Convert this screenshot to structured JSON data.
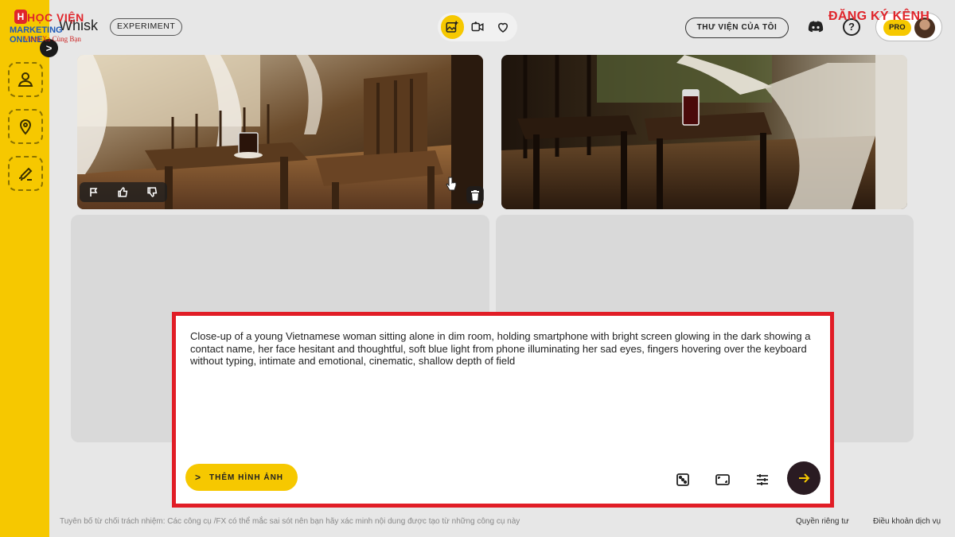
{
  "app": {
    "name": "Whisk",
    "badge": "EXPERIMENT"
  },
  "overlay_logo": {
    "initial": "H",
    "line1": "HỌC VIỆN",
    "line2": "MARKETING ONLINE",
    "tagline": "Vươn Xa Cùng Bạn"
  },
  "subscribe_watermark": "ĐĂNG KÝ KÊNH",
  "header": {
    "modes": [
      {
        "icon": "add-image-icon",
        "active": true
      },
      {
        "icon": "video-icon",
        "active": false
      },
      {
        "icon": "heart-icon",
        "active": false
      }
    ],
    "library_label": "THƯ VIỆN CỦA TÔI",
    "help_label": "?",
    "plan_badge": "PRO"
  },
  "sidebar": {
    "expand_label": ">",
    "items": [
      {
        "icon": "subject-icon"
      },
      {
        "icon": "location-icon"
      },
      {
        "icon": "style-icon"
      }
    ]
  },
  "gallery": {
    "images": [
      {
        "description": "Wooden veranda with table, chair and glass of coffee"
      },
      {
        "description": "Dark wooden porch with carved table and glass of iced drink"
      }
    ],
    "image_actions": [
      "flag-icon",
      "thumbs-up-icon",
      "thumbs-down-icon"
    ]
  },
  "composer": {
    "prompt": "Close-up of a young Vietnamese woman sitting alone in dim room, holding smartphone with bright screen glowing in the dark showing a contact name, her face hesitant and thoughtful, soft blue light from phone illuminating her sad eyes, fingers hovering over the keyboard without typing, intimate and emotional, cinematic, shallow depth of field",
    "add_image_label": "THÊM HÌNH ẢNH",
    "add_image_chevron": ">",
    "tools": [
      "dice-icon",
      "aspect-ratio-icon",
      "settings-sliders-icon"
    ]
  },
  "footer": {
    "disclaimer": "Tuyên bố từ chối trách nhiệm: Các công cụ /FX có thể mắc sai sót nên bạn hãy xác minh nội dung được tạo từ những công cụ này",
    "privacy": "Quyền riêng tư",
    "terms": "Điều khoản dịch vụ"
  },
  "colors": {
    "accent": "#f6c800",
    "highlight_border": "#e11d26",
    "send_button": "#2a1b22",
    "background": "#e7e7e7"
  }
}
